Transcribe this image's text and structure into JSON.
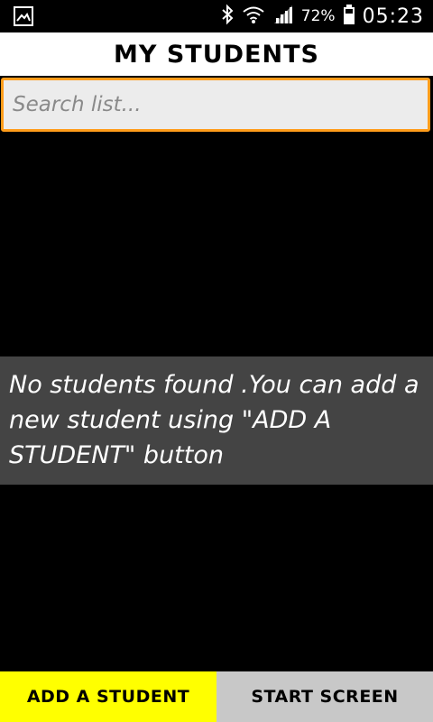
{
  "status_bar": {
    "left_icon": "image-notification-icon",
    "icons": [
      "bluetooth-icon",
      "wifi-icon",
      "signal-icon"
    ],
    "battery_percent": "72%",
    "time": "05:23"
  },
  "header": {
    "title": "MY STUDENTS"
  },
  "search": {
    "placeholder": "Search list...",
    "value": ""
  },
  "empty_state": {
    "message": "No students found .You can add a new student using \"ADD A STUDENT\" button"
  },
  "actions": {
    "add_label": "ADD A STUDENT",
    "start_label": "START SCREEN"
  },
  "colors": {
    "accent_border": "#ff9c1a",
    "add_button": "#ffff00",
    "start_button": "#c8c8c8",
    "empty_box": "#444444"
  }
}
